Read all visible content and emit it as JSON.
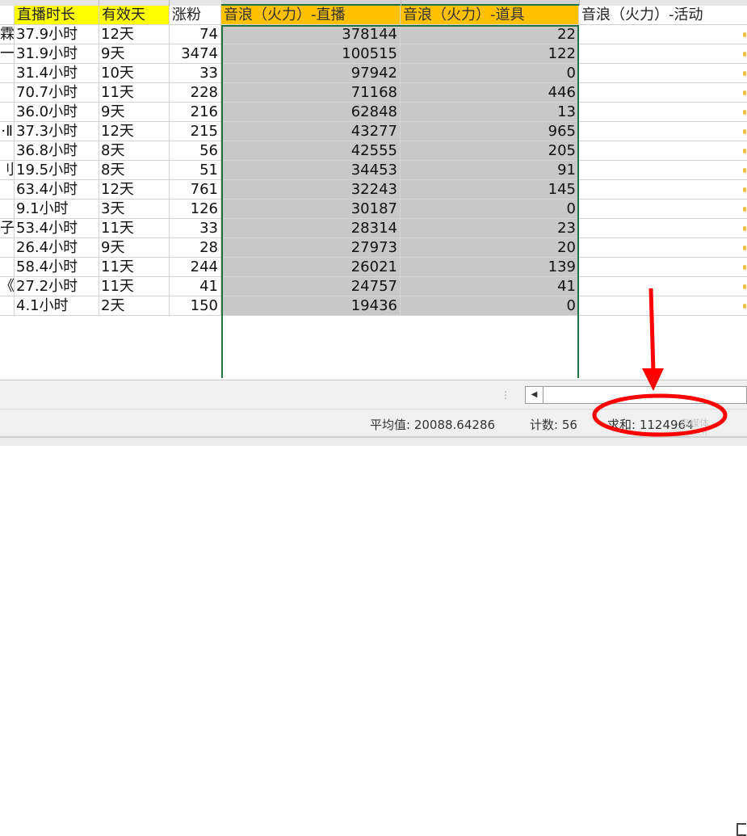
{
  "headers": {
    "duration": "直播时长",
    "valid_days": "有效天",
    "fans": "涨粉",
    "wave_live": "音浪（火力）-直播",
    "wave_props": "音浪（火力）-道具",
    "wave_event": "音浪（火力）-活动"
  },
  "rows": [
    {
      "clip": "霖",
      "duration": "37.9小时",
      "valid_days": "12天",
      "fans": "74",
      "wave_live": "378144",
      "wave_props": "22"
    },
    {
      "clip": "一",
      "duration": "31.9小时",
      "valid_days": "9天",
      "fans": "3474",
      "wave_live": "100515",
      "wave_props": "122"
    },
    {
      "clip": "",
      "duration": "31.4小时",
      "valid_days": "10天",
      "fans": "33",
      "wave_live": "97942",
      "wave_props": "0"
    },
    {
      "clip": "",
      "duration": "70.7小时",
      "valid_days": "11天",
      "fans": "228",
      "wave_live": "71168",
      "wave_props": "446"
    },
    {
      "clip": "",
      "duration": "36.0小时",
      "valid_days": "9天",
      "fans": "216",
      "wave_live": "62848",
      "wave_props": "13"
    },
    {
      "clip": "·Ⅱ",
      "duration": "37.3小时",
      "valid_days": "12天",
      "fans": "215",
      "wave_live": "43277",
      "wave_props": "965"
    },
    {
      "clip": "",
      "duration": "36.8小时",
      "valid_days": "8天",
      "fans": "56",
      "wave_live": "42555",
      "wave_props": "205"
    },
    {
      "clip": "刂",
      "duration": "19.5小时",
      "valid_days": "8天",
      "fans": "51",
      "wave_live": "34453",
      "wave_props": "91"
    },
    {
      "clip": "",
      "duration": "63.4小时",
      "valid_days": "12天",
      "fans": "761",
      "wave_live": "32243",
      "wave_props": "145"
    },
    {
      "clip": "",
      "duration": "9.1小时",
      "valid_days": "3天",
      "fans": "126",
      "wave_live": "30187",
      "wave_props": "0"
    },
    {
      "clip": "子",
      "duration": "53.4小时",
      "valid_days": "11天",
      "fans": "33",
      "wave_live": "28314",
      "wave_props": "23"
    },
    {
      "clip": "",
      "duration": "26.4小时",
      "valid_days": "9天",
      "fans": "28",
      "wave_live": "27973",
      "wave_props": "20"
    },
    {
      "clip": "",
      "duration": "58.4小时",
      "valid_days": "11天",
      "fans": "244",
      "wave_live": "26021",
      "wave_props": "139"
    },
    {
      "clip": "《",
      "duration": "27.2小时",
      "valid_days": "11天",
      "fans": "41",
      "wave_live": "24757",
      "wave_props": "41"
    },
    {
      "clip": "",
      "duration": "4.1小时",
      "valid_days": "2天",
      "fans": "150",
      "wave_live": "19436",
      "wave_props": "0"
    }
  ],
  "statusbar": {
    "average": "平均值: 20088.64286",
    "count": "计数: 56",
    "sum": "求和: 1124964"
  },
  "scrollbar": {
    "grip": "⋮",
    "left_arrow": "◀"
  },
  "watermark": {
    "line1": "自媒体",
    "line2": "www.pc.cn"
  },
  "colors": {
    "header_yellow": "#ffff00",
    "header_orange": "#ffc000",
    "selection_border": "#217346",
    "annotation_red": "#ff0000"
  }
}
